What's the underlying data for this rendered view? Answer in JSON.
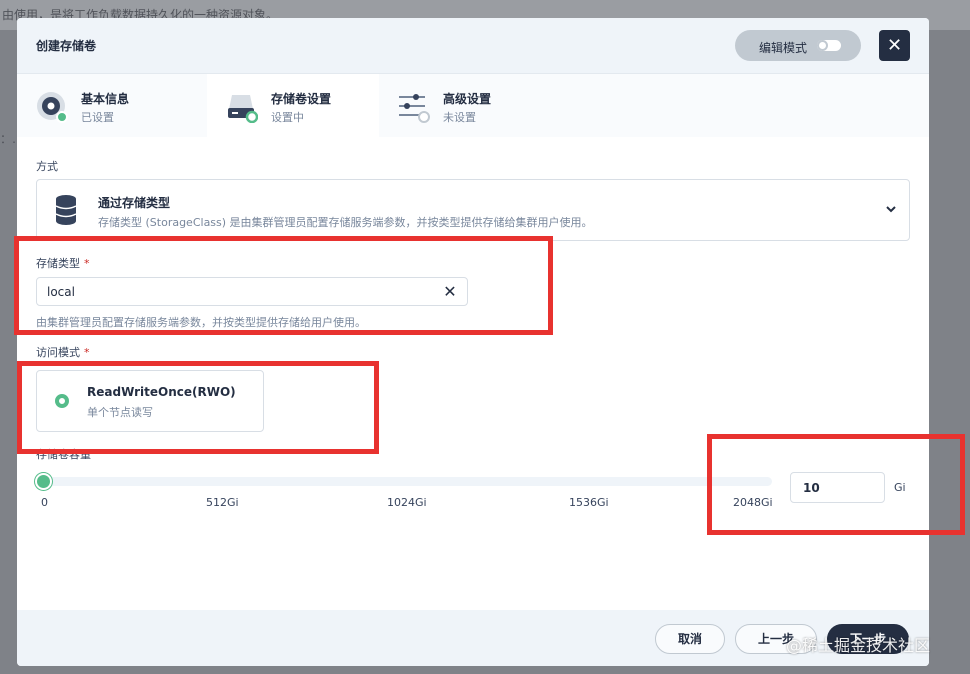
{
  "background": {
    "top_text": "由使用，是将工作负载数据持久化的一种资源对象。",
    "side_mark": "：…"
  },
  "modal": {
    "title": "创建存储卷",
    "edit_mode_label": "编辑模式",
    "close_glyph": "✕"
  },
  "steps": [
    {
      "title": "基本信息",
      "status": "已设置",
      "icon": "disk-icon"
    },
    {
      "title": "存储卷设置",
      "status": "设置中",
      "icon": "storage-drive-icon"
    },
    {
      "title": "高级设置",
      "status": "未设置",
      "icon": "sliders-icon"
    }
  ],
  "method": {
    "label": "方式",
    "title": "通过存储类型",
    "description": "存储类型 (StorageClass) 是由集群管理员配置存储服务端参数，并按类型提供存储给集群用户使用。"
  },
  "storage_class": {
    "label": "存储类型",
    "required_mark": "*",
    "value": "local",
    "clear_glyph": "✕",
    "help": "由集群管理员配置存储服务端参数，并按类型提供存储给用户使用。"
  },
  "access_mode": {
    "label": "访问模式",
    "required_mark": "*",
    "option_title": "ReadWriteOnce(RWO)",
    "option_desc": "单个节点读写"
  },
  "capacity": {
    "label": "存储卷容量",
    "ticks": [
      "0",
      "512Gi",
      "1024Gi",
      "1536Gi",
      "2048Gi"
    ],
    "slider_max": 2048,
    "slider_value": 10,
    "value": "10",
    "unit": "Gi"
  },
  "footer": {
    "cancel_label": "取消",
    "prev_label": "上一步",
    "next_label": "下一步"
  },
  "watermark": "@稀土掘金技术社区",
  "colors": {
    "accent_green": "#55bc8a",
    "dark": "#242e42",
    "annotation_red": "#e8322f"
  }
}
